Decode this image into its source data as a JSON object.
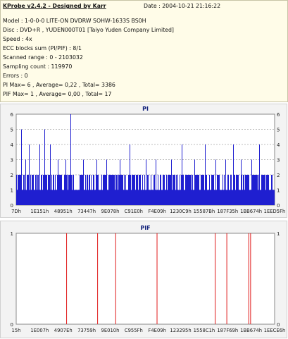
{
  "info": {
    "title": "KProbe v2.4.2 - Designed by Karr",
    "date": "Date : 2004-10-21 21:16:22",
    "lines": [
      "Model : 1-0-0-0 LITE-ON DVDRW SOHW-1633S BS0H",
      "Disc : DVD+R , YUDEN000T01 [Taiyo Yuden Company Limited]",
      "Speed : 4x",
      "ECC blocks sum (PI/PIF) : 8/1",
      "Scanned range : 0 - 2103032",
      "Sampling count : 119970",
      "Errors : 0",
      "PI Max= 6 , Average= 0,22 , Total= 3386",
      "PIF Max= 1 , Average= 0,00 , Total= 17"
    ]
  },
  "colors": {
    "pi": "#1f1fd0",
    "pif": "#e01b1b",
    "grid": "#7a7a7a",
    "title": "#10207a"
  },
  "chart_data": [
    {
      "type": "bar",
      "title": "PI",
      "ylim": [
        0,
        6
      ],
      "yticks": [
        "0",
        "1",
        "2",
        "3",
        "4",
        "5",
        "6"
      ],
      "xticks": [
        "7Dh",
        "1E151h",
        "48951h",
        "73447h",
        "9E078h",
        "C91E0h",
        "F4E09h",
        "1230C9h",
        "15587Bh",
        "187F35h",
        "1BB674h",
        "1EED5Fh"
      ],
      "grid": true,
      "baseline_level": 1,
      "frequent_level": 2,
      "spikes": [
        {
          "x": 0.02,
          "value": 5
        },
        {
          "x": 0.035,
          "value": 3
        },
        {
          "x": 0.05,
          "value": 4
        },
        {
          "x": 0.09,
          "value": 4
        },
        {
          "x": 0.11,
          "value": 5
        },
        {
          "x": 0.13,
          "value": 4
        },
        {
          "x": 0.16,
          "value": 3
        },
        {
          "x": 0.19,
          "value": 3
        },
        {
          "x": 0.21,
          "value": 6
        },
        {
          "x": 0.26,
          "value": 3
        },
        {
          "x": 0.31,
          "value": 3
        },
        {
          "x": 0.35,
          "value": 3
        },
        {
          "x": 0.4,
          "value": 3
        },
        {
          "x": 0.44,
          "value": 4
        },
        {
          "x": 0.5,
          "value": 3
        },
        {
          "x": 0.54,
          "value": 3
        },
        {
          "x": 0.6,
          "value": 3
        },
        {
          "x": 0.64,
          "value": 4
        },
        {
          "x": 0.69,
          "value": 3
        },
        {
          "x": 0.73,
          "value": 4
        },
        {
          "x": 0.77,
          "value": 3
        },
        {
          "x": 0.81,
          "value": 3
        },
        {
          "x": 0.84,
          "value": 4
        },
        {
          "x": 0.87,
          "value": 3
        },
        {
          "x": 0.91,
          "value": 3
        },
        {
          "x": 0.94,
          "value": 4
        }
      ]
    },
    {
      "type": "bar",
      "title": "PIF",
      "ylim": [
        0,
        1
      ],
      "yticks": [
        "0",
        "1"
      ],
      "xticks": [
        "15h",
        "1E007h",
        "4907Eh",
        "73759h",
        "9E010h",
        "C955Fh",
        "F4E09h",
        "123295h",
        "1558C1h",
        "187F69h",
        "1BB674h",
        "1EECE6h"
      ],
      "grid": true,
      "spikes": [
        {
          "x": 0.195,
          "value": 1
        },
        {
          "x": 0.315,
          "value": 1
        },
        {
          "x": 0.385,
          "value": 1
        },
        {
          "x": 0.545,
          "value": 1
        },
        {
          "x": 0.77,
          "value": 1
        },
        {
          "x": 0.815,
          "value": 1
        },
        {
          "x": 0.9,
          "value": 1
        },
        {
          "x": 0.907,
          "value": 1
        }
      ]
    }
  ]
}
